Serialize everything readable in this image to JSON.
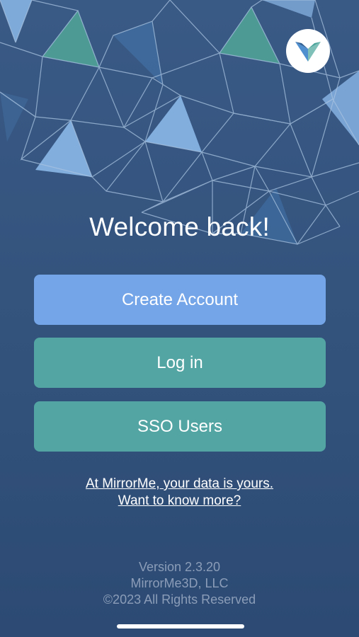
{
  "app": {
    "brand_logo_icon": "mirrorme-logo-icon"
  },
  "header": {
    "title": "Welcome back!"
  },
  "actions": {
    "create_account_label": "Create Account",
    "login_label": "Log in",
    "sso_label": "SSO Users"
  },
  "privacy": {
    "line1": "At MirrorMe, your data is yours.",
    "line2": "Want to know more?"
  },
  "footer": {
    "version": "Version 2.3.20",
    "company": "MirrorMe3D, LLC",
    "copyright": "©2023 All Rights Reserved"
  },
  "colors": {
    "background": "#34547e",
    "create_button": "#73a5e8",
    "primary_button": "#52a5a3",
    "footer_text": "#8b9db8"
  }
}
